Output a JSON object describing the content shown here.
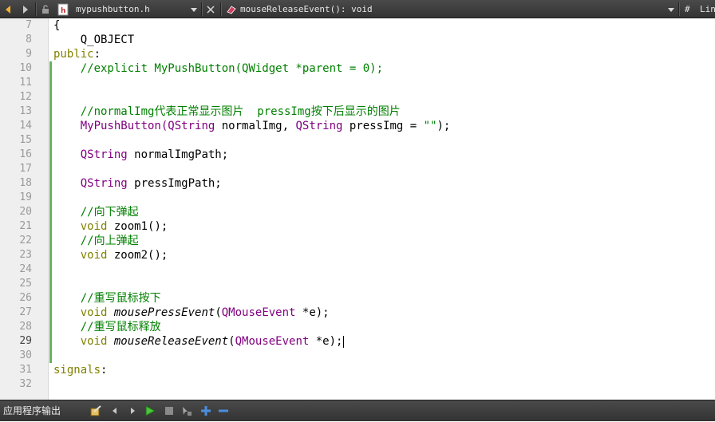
{
  "toolbar": {
    "file_name": "mypushbutton.h",
    "function_name": "mouseReleaseEvent(): void",
    "hash_symbol": "#",
    "line_label": "Lin"
  },
  "editor": {
    "lines": [
      {
        "n": "7"
      },
      {
        "n": "8"
      },
      {
        "n": "9"
      },
      {
        "n": "10"
      },
      {
        "n": "11"
      },
      {
        "n": "12"
      },
      {
        "n": "13"
      },
      {
        "n": "14"
      },
      {
        "n": "15"
      },
      {
        "n": "16"
      },
      {
        "n": "17"
      },
      {
        "n": "18"
      },
      {
        "n": "19"
      },
      {
        "n": "20"
      },
      {
        "n": "21"
      },
      {
        "n": "22"
      },
      {
        "n": "23"
      },
      {
        "n": "24"
      },
      {
        "n": "25"
      },
      {
        "n": "26"
      },
      {
        "n": "27"
      },
      {
        "n": "28"
      },
      {
        "n": "29"
      },
      {
        "n": "30"
      },
      {
        "n": "31"
      },
      {
        "n": "32"
      }
    ],
    "code": {
      "l7": "{",
      "l8": "    Q_OBJECT",
      "l9_kw": "public",
      "l9_rest": ":",
      "l10": "    //explicit MyPushButton(QWidget *parent = 0);",
      "l13": "    //normalImg代表正常显示图片  pressImg按下后显示的图片",
      "l14_a": "    MyPushButton(",
      "l14_t1": "QString",
      "l14_b": " normalImg, ",
      "l14_t2": "QString",
      "l14_c": " pressImg = ",
      "l14_str": "\"\"",
      "l14_d": ");",
      "l16_t": "QString",
      "l16_rest": " normalImgPath;",
      "l18_t": "QString",
      "l18_rest": " pressImgPath;",
      "l20": "    //向下弹起",
      "l21_kw": "void",
      "l21_rest": " zoom1();",
      "l22": "    //向上弹起",
      "l23_kw": "void",
      "l23_rest": " zoom2();",
      "l26": "    //重写鼠标按下",
      "l27_kw": "void",
      "l27_fn": "mousePressEvent",
      "l27_p": "(",
      "l27_t": "QMouseEvent",
      "l27_rest": " *e);",
      "l28": "    //重写鼠标释放",
      "l29_kw": "void",
      "l29_fn": "mouseReleaseEvent",
      "l29_p": "(",
      "l29_t": "QMouseEvent",
      "l29_rest": " *e);",
      "l31_kw": "signals",
      "l31_rest": ":"
    }
  },
  "bottom": {
    "label": "应用程序输出"
  },
  "colors": {
    "keyword": "#808000",
    "type": "#800080",
    "comment": "#008000",
    "gutter": "#efefef",
    "toolbar": "#3c3c3c"
  }
}
